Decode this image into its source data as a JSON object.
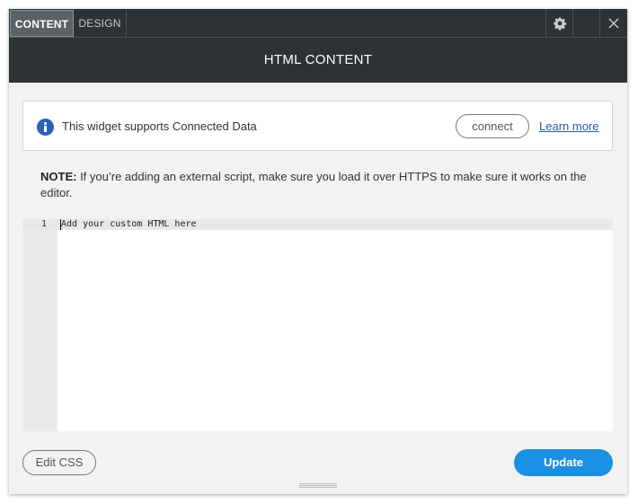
{
  "tabs": [
    {
      "label": "CONTENT",
      "active": true
    },
    {
      "label": "DESIGN",
      "active": false
    }
  ],
  "toolbar": {
    "settings_icon": "gear-icon",
    "close_icon": "close-icon"
  },
  "header": {
    "title": "HTML CONTENT"
  },
  "connected_data": {
    "icon": "info-icon",
    "message": "This widget supports Connected Data",
    "connect_label": "connect",
    "learn_more_label": "Learn more"
  },
  "note": {
    "prefix": "NOTE:",
    "text": " If you’re adding an external script, make sure you load it over HTTPS to make sure it works on the editor."
  },
  "editor": {
    "lines": [
      {
        "number": "1",
        "text": "Add your custom HTML here"
      }
    ]
  },
  "footer": {
    "edit_css_label": "Edit CSS",
    "update_label": "Update"
  },
  "colors": {
    "header_bg": "#2d3235",
    "active_tab_bg": "#5a6266",
    "accent": "#1a8fe3",
    "info_icon": "#2962b8",
    "link": "#2a5da8",
    "panel_bg": "#f2f2f2"
  }
}
